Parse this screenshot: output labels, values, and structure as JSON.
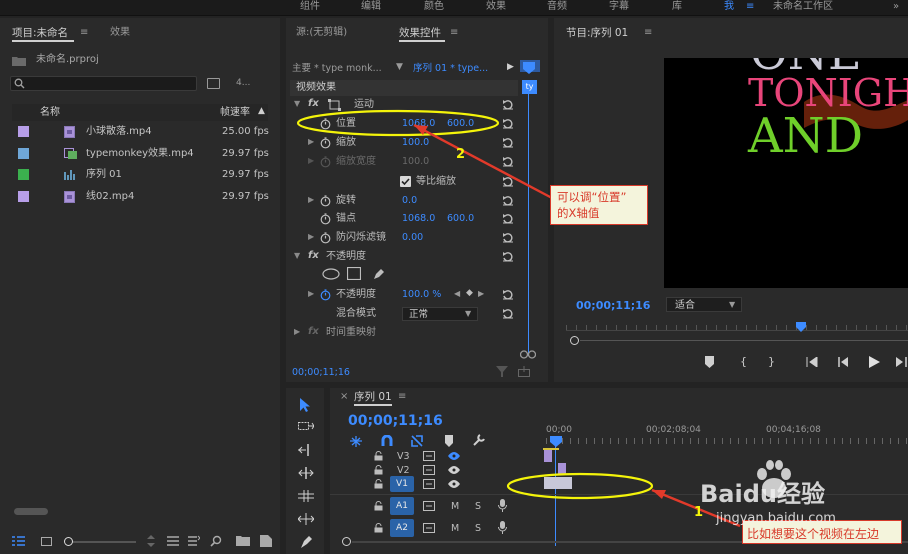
{
  "workspace_tabs": [
    "组件",
    "编辑",
    "颜色",
    "效果",
    "音频",
    "字幕",
    "库",
    "我",
    "未命名工作区"
  ],
  "workspace_menu": "≡",
  "workspace_more": "»",
  "project_panel": {
    "title": "项目:未命名",
    "menu": "≡",
    "tab_effects": "效果",
    "project_file": "未命名.prproj",
    "search_placeholder": "",
    "item_count": "4...",
    "columns": {
      "name": "名称",
      "fps": "帧速率"
    },
    "items": [
      {
        "name": "小球散落.mp4",
        "fps": "25.00 fps",
        "color": "#b79ee8"
      },
      {
        "name": "typemonkey效果.mp4",
        "fps": "29.97 fps",
        "color": "#6fa7d8"
      },
      {
        "name": "序列 01",
        "fps": "29.97 fps",
        "color": "#3bb04e"
      },
      {
        "name": "线02.mp4",
        "fps": "29.97 fps",
        "color": "#b79ee8"
      }
    ]
  },
  "effect_controls": {
    "tab_source": "源:(无剪辑)",
    "tab_effect_controls": "效果控件",
    "menu": "≡",
    "master_clip": "主要 * type monk...",
    "sequence_clip": "序列 01 * type...",
    "section_video": "视频效果",
    "motion": "运动",
    "position_label": "位置",
    "position_x": "1068.0",
    "position_y": "600.0",
    "scale_label": "缩放",
    "scale_value": "100.0",
    "scale_width_label": "缩放宽度",
    "scale_width_value": "100.0",
    "uniform_scale": "等比缩放",
    "rotation_label": "旋转",
    "rotation_value": "0.0",
    "anchor_label": "锚点",
    "anchor_x": "1068.0",
    "anchor_y": "600.0",
    "flicker_label": "防闪烁滤镜",
    "flicker_value": "0.00",
    "opacity_section": "不透明度",
    "opacity_label": "不透明度",
    "opacity_value": "100.0 %",
    "blend_label": "混合模式",
    "blend_value": "正常",
    "time_remap": "时间重映射",
    "timecode": "00;00;11;16"
  },
  "program_monitor": {
    "title": "节目:序列 01",
    "menu": "≡",
    "timecode": "00;00;11;16",
    "fit": "适合",
    "preview_text": [
      "ONE",
      "TONIGHT",
      "AND"
    ]
  },
  "timeline": {
    "title": "序列 01",
    "menu": "≡",
    "timecode": "00;00;11;16",
    "ruler": [
      "00;00",
      "00;02;08;04",
      "00;04;16;08"
    ],
    "tracks_video": [
      "V3",
      "V2",
      "V1"
    ],
    "tracks_audio": [
      "A1",
      "A2"
    ],
    "mute": "M",
    "solo": "S"
  },
  "annotations": {
    "step1": "1",
    "step2": "2",
    "note_position": "可以调“位置”\n的X轴值",
    "note_left": "比如想要这个视频在左边"
  },
  "watermark": {
    "brand": "Baidu经验",
    "url": "jingyan.baidu.com"
  },
  "colors": {
    "accent": "#3d8bff",
    "highlight_ellipse": "#f4f40a",
    "arrow": "#e23a2a",
    "green_text": "#6fcf2a",
    "pink_text": "#e8457a"
  }
}
